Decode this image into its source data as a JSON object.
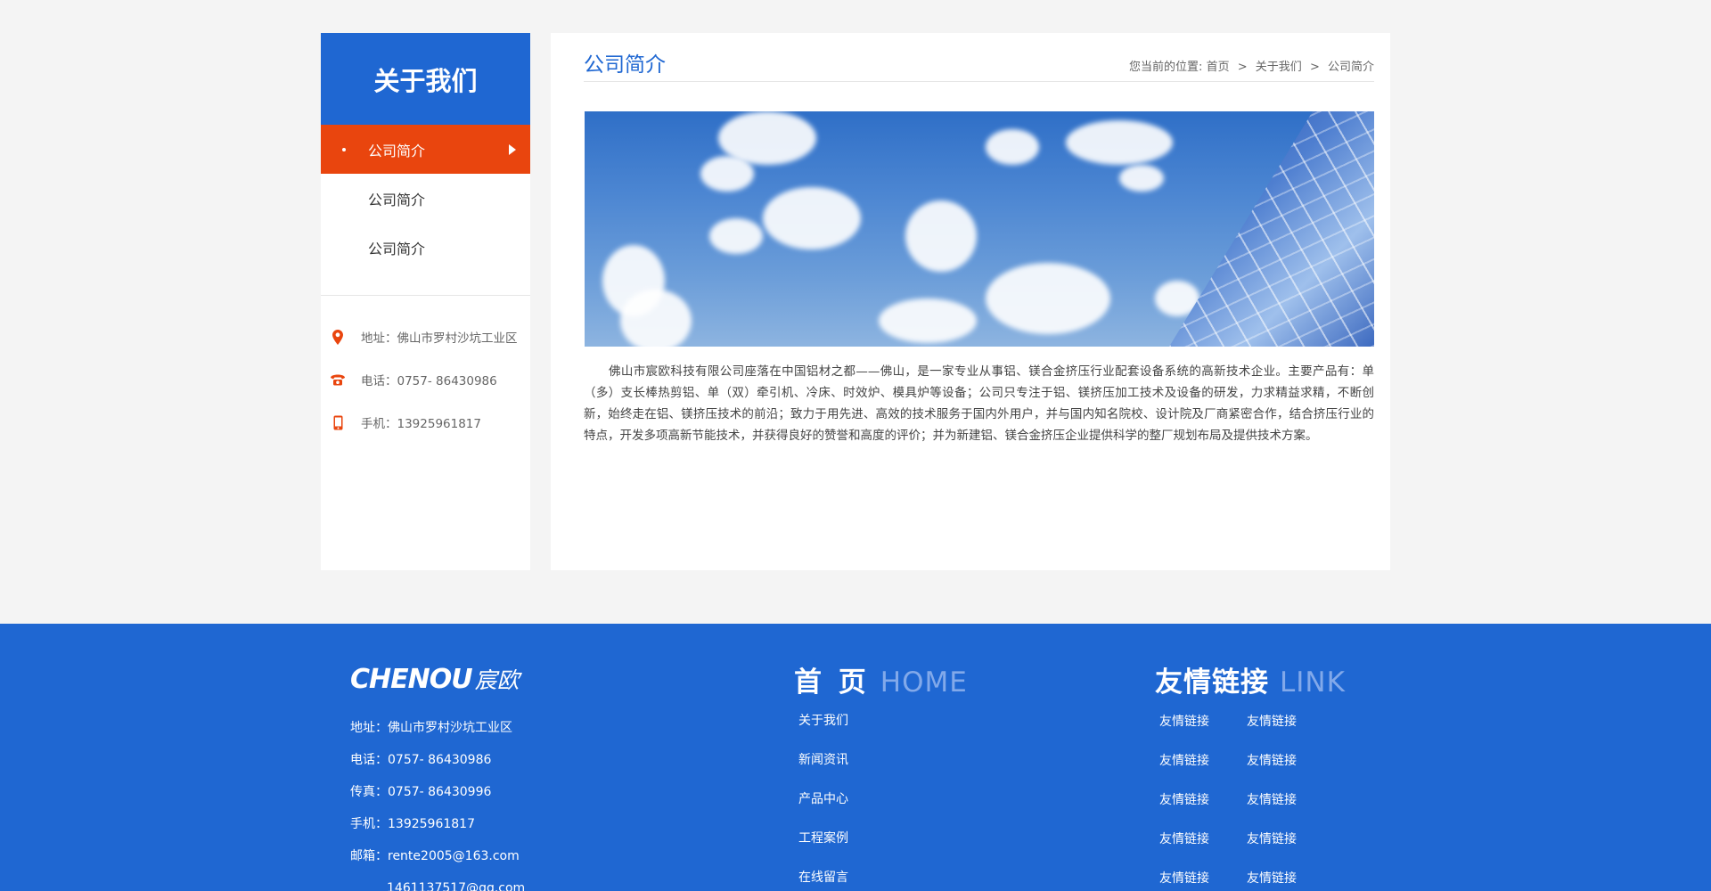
{
  "sidebar": {
    "title": "关于我们",
    "items": [
      {
        "label": "公司简介",
        "active": true
      },
      {
        "label": "公司简介",
        "active": false
      },
      {
        "label": "公司简介",
        "active": false
      }
    ],
    "contacts": {
      "address": "地址：佛山市罗村沙坑工业区",
      "phone": "电话：0757- 86430986",
      "mobile": "手机：13925961817"
    }
  },
  "main": {
    "title": "公司简介",
    "breadcrumb": {
      "prefix": "您当前的位置:",
      "home": "首页",
      "about": "关于我们",
      "current": "公司简介",
      "separator": ">"
    },
    "intro": "佛山市宸欧科技有限公司座落在中国铝材之都——佛山，是一家专业从事铝、镁合金挤压行业配套设备系统的高新技术企业。主要产品有：单（多）支长棒热剪铝、单（双）牵引机、冷床、时效炉、模具炉等设备；公司只专注于铝、镁挤压加工技术及设备的研发，力求精益求精，不断创新，始终走在铝、镁挤压技术的前沿；致力于用先进、高效的技术服务于国内外用户，并与国内知名院校、设计院及厂商紧密合作，结合挤压行业的特点，开发多项高新节能技术，并获得良好的赞誉和高度的评价；并为新建铝、镁合金挤压企业提供科学的整厂规划布局及提供技术方案。"
  },
  "footer": {
    "logo_en": "CHENOU",
    "logo_cn": "宸欧",
    "contact": {
      "address": "地址：佛山市罗村沙坑工业区",
      "phone": "电话：0757- 86430986",
      "fax": "传真：0757- 86430996",
      "mobile": "手机：13925961817",
      "email": "邮箱：rente2005@163.com",
      "email2": "1461137517@qq.com"
    },
    "nav": {
      "title_cn": "首 页",
      "title_en": "HOME",
      "links": [
        "关于我们",
        "新闻资讯",
        "产品中心",
        "工程案例",
        "在线留言"
      ]
    },
    "friend_links": {
      "title_cn": "友情链接",
      "title_en": "LINK",
      "links": [
        "友情链接",
        "友情链接",
        "友情链接",
        "友情链接",
        "友情链接",
        "友情链接",
        "友情链接",
        "友情链接",
        "友情链接",
        "友情链接"
      ]
    }
  },
  "colors": {
    "brand_blue": "#1f67d2",
    "active_orange": "#e9450e",
    "page_bg": "#f4f4f4"
  },
  "icons": {
    "address": "map-pin-icon",
    "phone": "telephone-icon",
    "mobile": "mobile-phone-icon"
  }
}
